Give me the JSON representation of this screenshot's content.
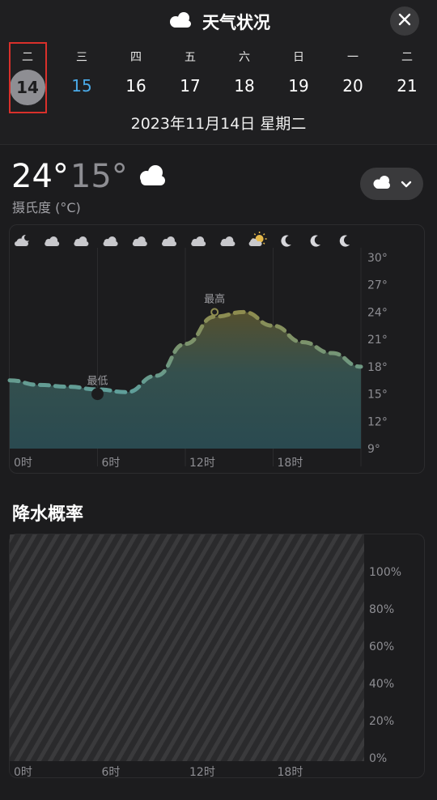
{
  "header": {
    "title": "天气状况"
  },
  "days": [
    {
      "weekday": "二",
      "date": "14"
    },
    {
      "weekday": "三",
      "date": "15"
    },
    {
      "weekday": "四",
      "date": "16"
    },
    {
      "weekday": "五",
      "date": "17"
    },
    {
      "weekday": "六",
      "date": "18"
    },
    {
      "weekday": "日",
      "date": "19"
    },
    {
      "weekday": "一",
      "date": "20"
    },
    {
      "weekday": "二",
      "date": "21"
    }
  ],
  "selected_date_full": "2023年11月14日 星期二",
  "summary": {
    "high": "24°",
    "low": "15°",
    "unit_label": "摄氏度 (°C)"
  },
  "hourly_icons": [
    "partly-cloudy-night-icon",
    "cloud-icon",
    "cloud-icon",
    "cloud-icon",
    "cloud-icon",
    "cloud-icon",
    "cloud-icon",
    "cloud-icon",
    "partly-sunny-icon",
    "moon-icon",
    "moon-icon",
    "moon-icon"
  ],
  "temp_chart": {
    "min_label": "最低",
    "max_label": "最高",
    "y_ticks": [
      "30°",
      "27°",
      "24°",
      "21°",
      "18°",
      "15°",
      "12°",
      "9°"
    ],
    "x_ticks": [
      "0时",
      "6时",
      "12时",
      "18时"
    ]
  },
  "precip": {
    "title": "降水概率",
    "y_ticks": [
      "100%",
      "80%",
      "60%",
      "40%",
      "20%",
      "0%"
    ],
    "x_ticks": [
      "0时",
      "6时",
      "12时",
      "18时"
    ]
  },
  "chart_data": [
    {
      "type": "area",
      "xlabel": "",
      "ylabel": "",
      "ylim": [
        9,
        30
      ],
      "x": [
        0,
        2,
        4,
        6,
        8,
        10,
        12,
        14,
        16,
        18,
        20,
        22,
        24
      ],
      "values": [
        16.5,
        16,
        15.8,
        15.5,
        15.2,
        17,
        20.5,
        23.5,
        24,
        22.5,
        20.7,
        19.5,
        18
      ],
      "min_point": {
        "x": 6,
        "y": 15
      },
      "max_point": {
        "x": 14,
        "y": 24
      },
      "colors": {
        "low": "#5f9e9a",
        "high": "#8e8c4f",
        "area": "#2c5055"
      }
    },
    {
      "type": "area",
      "xlabel": "",
      "ylabel": "",
      "ylim": [
        0,
        100
      ],
      "x": [
        0,
        6,
        12,
        18,
        24
      ],
      "values": []
    }
  ]
}
